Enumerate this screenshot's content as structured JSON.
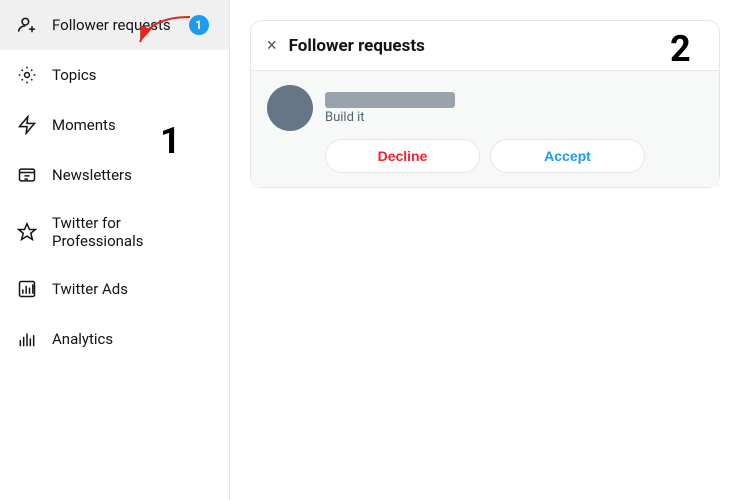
{
  "sidebar": {
    "items": [
      {
        "id": "follower-requests",
        "label": "Follower requests",
        "badge": "1",
        "active": true
      },
      {
        "id": "topics",
        "label": "Topics"
      },
      {
        "id": "moments",
        "label": "Moments"
      },
      {
        "id": "newsletters",
        "label": "Newsletters"
      },
      {
        "id": "twitter-for-professionals",
        "label": "Twitter for Professionals"
      },
      {
        "id": "twitter-ads",
        "label": "Twitter Ads"
      },
      {
        "id": "analytics",
        "label": "Analytics"
      }
    ]
  },
  "panel": {
    "title": "Follower requests",
    "close_label": "×"
  },
  "follower_request": {
    "username": "Build it",
    "decline_label": "Decline",
    "accept_label": "Accept"
  },
  "annotations": {
    "number1": "1",
    "number2": "2"
  }
}
